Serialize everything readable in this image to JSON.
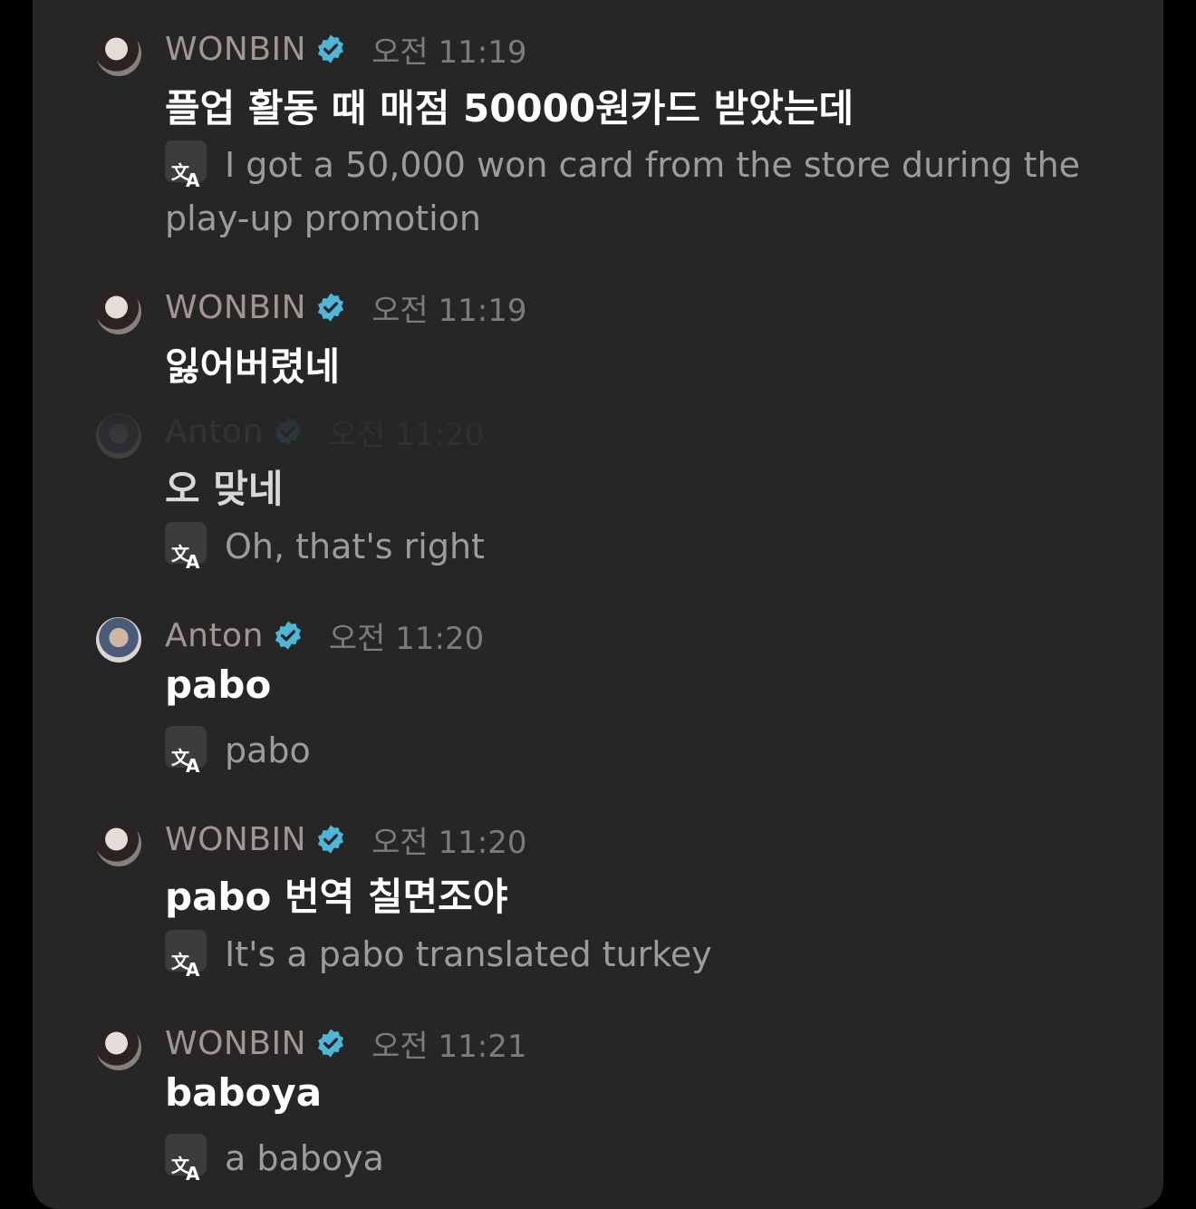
{
  "colors": {
    "panel": "#262627",
    "name": "#a39692",
    "timestamp": "#7c7c80",
    "message": "#ffffff",
    "translation": "#9c9c9f",
    "verified_badge": "#4fb6d8"
  },
  "translate_icon_glyphs": [
    "文",
    "A"
  ],
  "messages": [
    {
      "author": "WONBIN",
      "time": "오전 11:19",
      "text": "플업 활동 때 매점 50000원카드 받았는데",
      "translation": "I got a 50,000 won card from the store during the play-up promotion"
    },
    {
      "author": "WONBIN",
      "time": "오전 11:19",
      "text": "잃어버렸네"
    },
    {
      "author": "Anton",
      "time": "오전 11:20",
      "text": "오 맞네",
      "translation": "Oh, that's right"
    },
    {
      "author": "Anton",
      "time": "오전 11:20",
      "text": "pabo",
      "translation": "pabo"
    },
    {
      "author": "WONBIN",
      "time": "오전 11:20",
      "text": "pabo 번역 칠면조야",
      "translation": "It's a pabo translated turkey"
    },
    {
      "author": "WONBIN",
      "time": "오전 11:21",
      "text": "baboya",
      "translation": "a baboya"
    }
  ]
}
